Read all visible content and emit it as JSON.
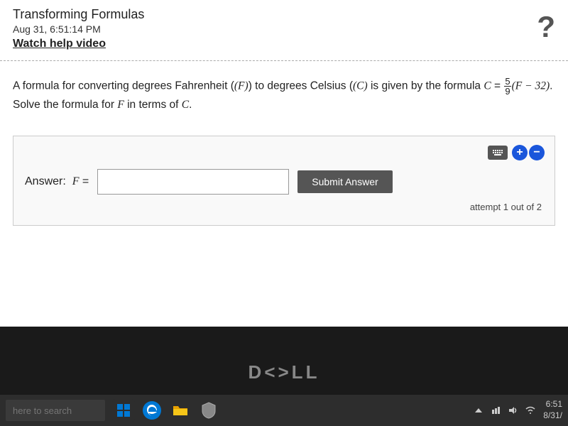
{
  "page": {
    "title": "Transforming Formulas",
    "timestamp": "Aug 31, 6:51:14 PM",
    "watch_help": "Watch help video",
    "problem_text_part1": "A formula for converting degrees Fahrenheit (",
    "problem_f": "F",
    "problem_text_part2": ") to degrees Celsius (",
    "problem_c": "C",
    "problem_text_part3": ") is given by the formula ",
    "problem_c2": "C",
    "problem_eq": " = ",
    "fraction_num": "5",
    "fraction_den": "9",
    "problem_expr": "(F − 32). Solve the formula for ",
    "problem_f2": "F",
    "problem_end": " in terms of ",
    "problem_c3": "C",
    "problem_period": ".",
    "answer_label": "Answer:",
    "answer_f": "F =",
    "answer_placeholder": "",
    "submit_label": "Submit Answer",
    "attempt_text": "attempt 1 out of 2"
  },
  "taskbar": {
    "search_placeholder": "here to search",
    "time": "6:51",
    "date": "8/31/"
  }
}
